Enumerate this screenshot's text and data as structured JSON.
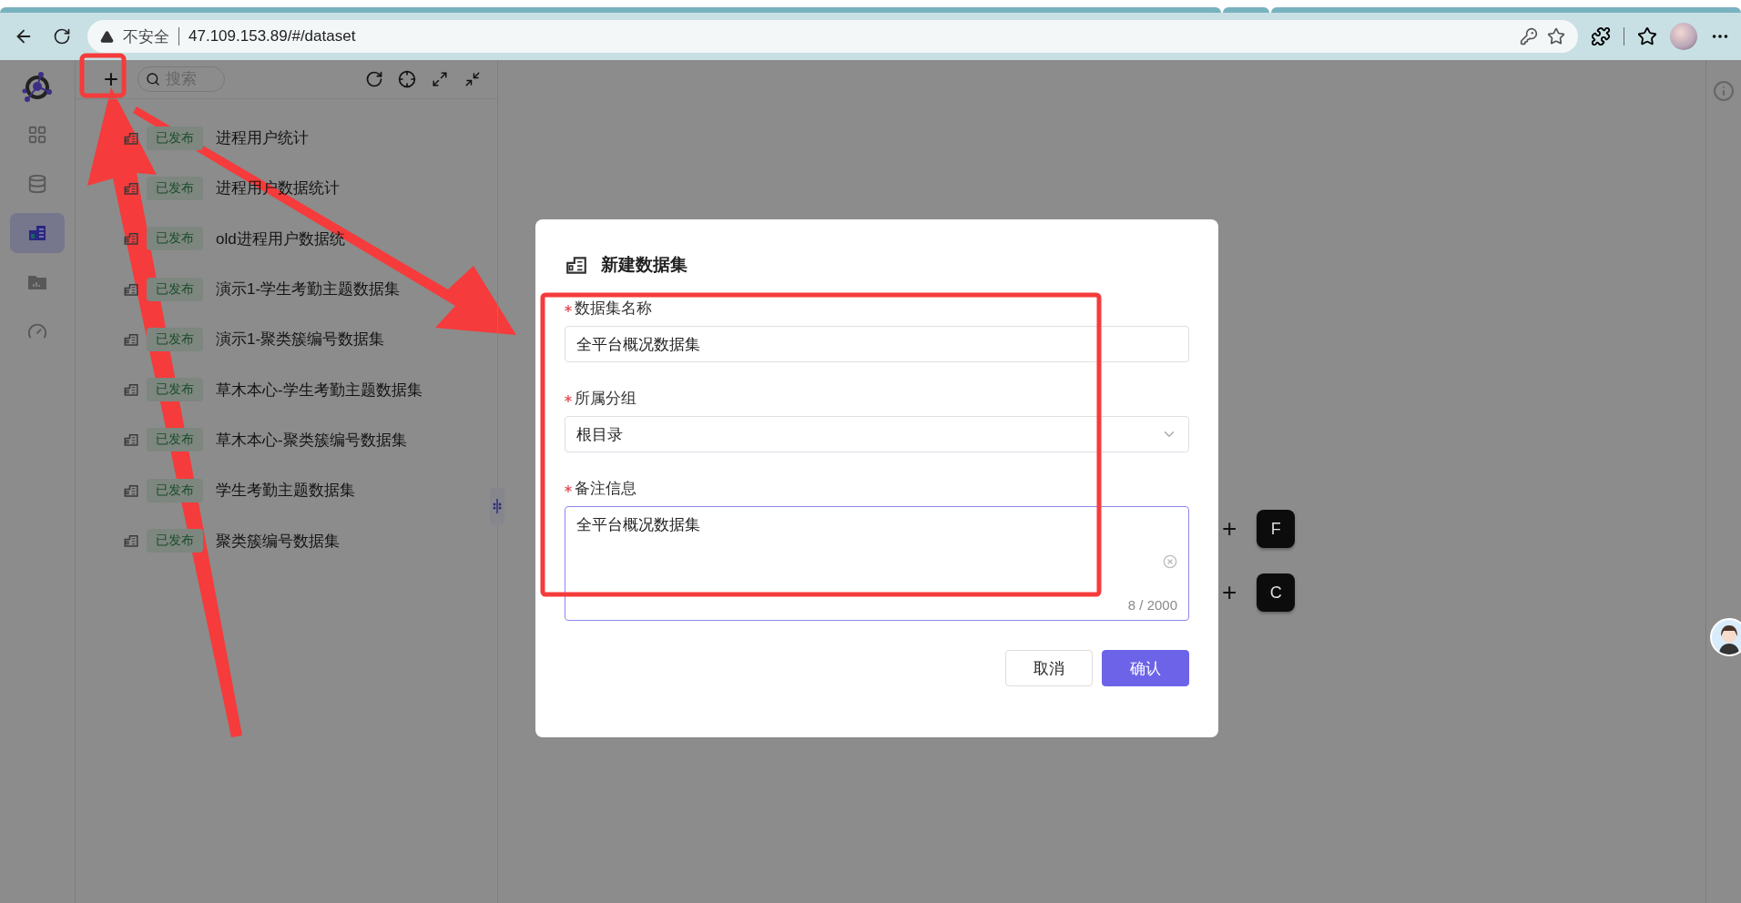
{
  "browser": {
    "security": "不安全",
    "url": "47.109.153.89/#/dataset"
  },
  "rail": {
    "items": [
      {
        "kind": "apps",
        "selected": false
      },
      {
        "kind": "database",
        "selected": false
      },
      {
        "kind": "dataset",
        "selected": true
      },
      {
        "kind": "folder",
        "selected": false
      },
      {
        "kind": "gauge",
        "selected": false
      }
    ]
  },
  "tree": {
    "add_button": "+",
    "search": {
      "placeholder": "搜索"
    },
    "items": [
      {
        "status": "已发布",
        "name": "进程用户统计"
      },
      {
        "status": "已发布",
        "name": "进程用户数据统计"
      },
      {
        "status": "已发布",
        "name": "old进程用户数据统"
      },
      {
        "status": "已发布",
        "name": "演示1-学生考勤主题数据集"
      },
      {
        "status": "已发布",
        "name": "演示1-聚类簇编号数据集"
      },
      {
        "status": "已发布",
        "name": "草木本心-学生考勤主题数据集"
      },
      {
        "status": "已发布",
        "name": "草木本心-聚类簇编号数据集"
      },
      {
        "status": "已发布",
        "name": "学生考勤主题数据集"
      },
      {
        "status": "已发布",
        "name": "聚类簇编号数据集"
      }
    ]
  },
  "canvas": {
    "nodes": [
      {
        "plus": "+",
        "letter": "F"
      },
      {
        "plus": "+",
        "letter": "C"
      }
    ]
  },
  "dialog": {
    "title": "新建数据集",
    "fields": [
      {
        "kind": "input",
        "label": "数据集名称",
        "required": true,
        "value": "全平台概况数据集"
      },
      {
        "kind": "select",
        "label": "所属分组",
        "required": true,
        "value": "根目录"
      },
      {
        "kind": "textarea",
        "label": "备注信息",
        "required": true,
        "value": "全平台概况数据集",
        "counter": "8 / 2000"
      }
    ],
    "buttons": [
      {
        "label": "取消",
        "primary": false
      },
      {
        "label": "确认",
        "primary": true
      }
    ]
  }
}
